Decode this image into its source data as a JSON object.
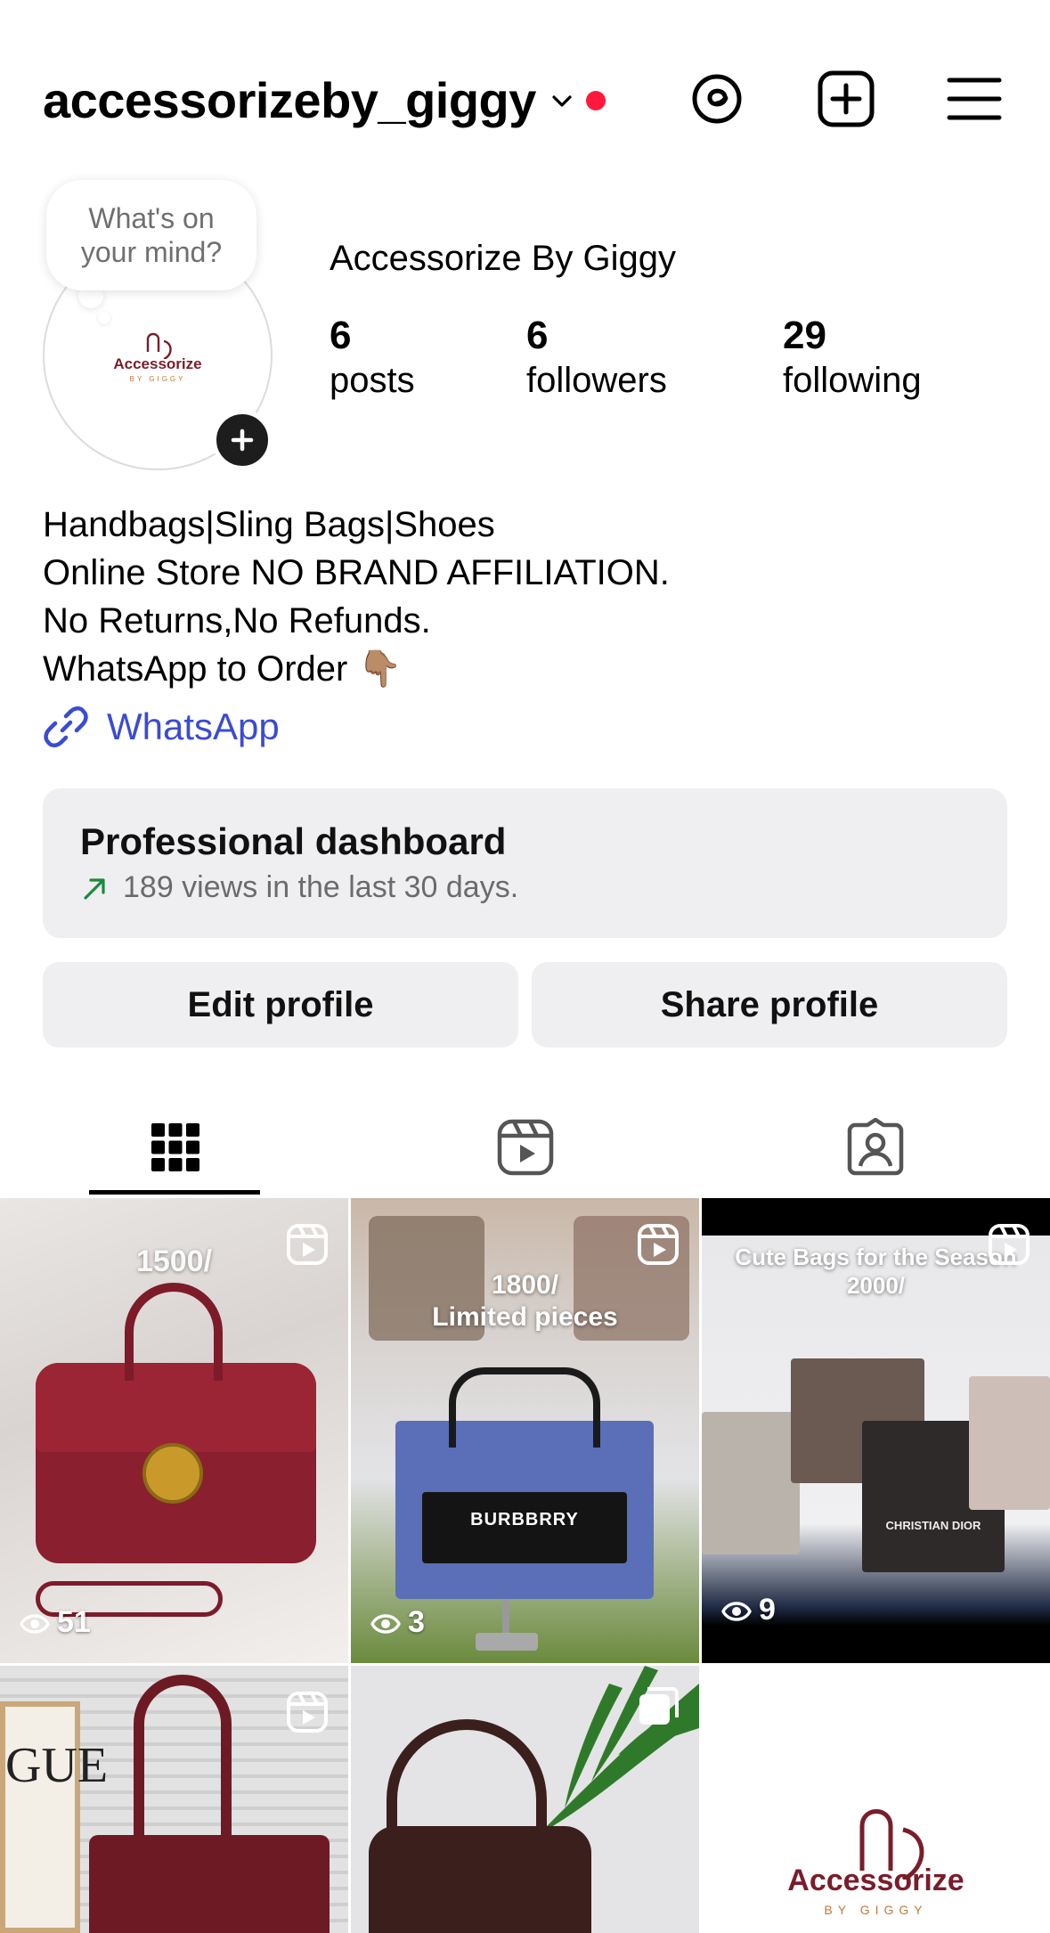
{
  "header": {
    "username": "accessorizeby_giggy",
    "has_notification": true,
    "icons": [
      "threads-icon",
      "add-post-icon",
      "menu-icon"
    ]
  },
  "note": {
    "text": "What's on your mind?"
  },
  "avatar": {
    "logo_text": "Accessorize",
    "logo_sub": "BY GIGGY"
  },
  "profile": {
    "display_name": "Accessorize By Giggy",
    "stats": [
      {
        "num": "6",
        "label": "posts"
      },
      {
        "num": "6",
        "label": "followers"
      },
      {
        "num": "29",
        "label": "following"
      }
    ]
  },
  "bio": {
    "lines": [
      "Handbags|Sling Bags|Shoes",
      "Online Store NO BRAND AFFILIATION.",
      "No Returns,No Refunds.",
      "WhatsApp to Order 👇🏽"
    ],
    "link_label": "WhatsApp"
  },
  "dashboard": {
    "title": "Professional dashboard",
    "subtitle": "189 views in the last 30 days."
  },
  "buttons": {
    "edit": "Edit profile",
    "share": "Share profile"
  },
  "tabs": [
    "grid-tab",
    "reels-tab",
    "tagged-tab"
  ],
  "grid": {
    "posts": [
      {
        "overlay": "1500/",
        "views": "51",
        "type": "reel"
      },
      {
        "overlay": "1800/\nLimited pieces",
        "views": "3",
        "type": "reel"
      },
      {
        "overlay": "Cute Bags for the Season\n2000/",
        "views": "9",
        "type": "reel"
      },
      {
        "overlay": "",
        "views": "",
        "type": "reel"
      },
      {
        "overlay": "",
        "views": "",
        "type": "carousel"
      },
      {
        "overlay": "",
        "views": "",
        "type": "image",
        "logo_text": "Accessorize",
        "logo_sub": "BY GIGGY"
      }
    ],
    "bag_labels": [
      "BURBBRRY",
      "CHRISTIAN DIOR",
      "GUE"
    ]
  },
  "colors": {
    "accent_link": "#3a4bd4",
    "notification": "#ff1a3b",
    "card_bg": "#efeff2",
    "trend_green": "#1a8a3a"
  }
}
